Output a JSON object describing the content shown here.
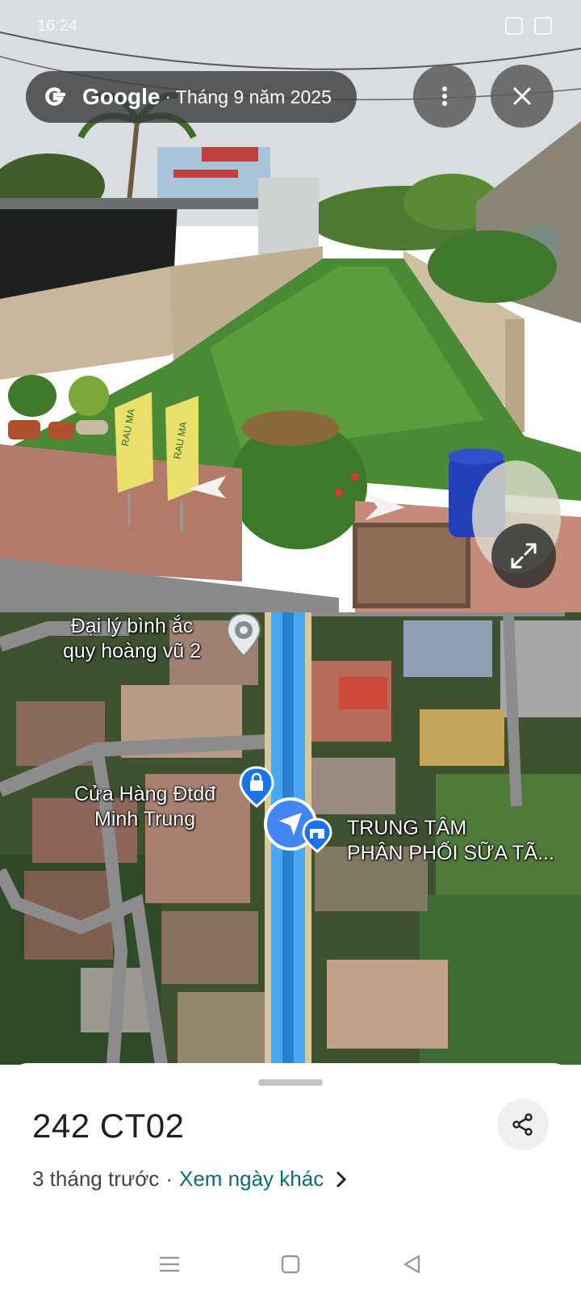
{
  "status_bar": {
    "time": "16:24"
  },
  "street_view": {
    "brand": "Google",
    "separator": "·",
    "capture_date": "Tháng 9 năm 2025"
  },
  "map": {
    "labels": [
      {
        "line1": "Đại lý bình ắc",
        "line2": "quy hoàng vũ 2"
      },
      {
        "line1": "Cửa Hàng Đtdđ",
        "line2": "Minh Trung"
      },
      {
        "line1": "TRUNG TÂM",
        "line2": "PHÂN PHỐI SỮA TÃ..."
      }
    ]
  },
  "sheet": {
    "title": "242 CT02",
    "age": "3 tháng trước",
    "separator": "·",
    "link": "Xem ngày khác"
  },
  "colors": {
    "accent": "#0b6b74",
    "pin_blue": "#1a73e8",
    "route_blue": "#4aa8f0"
  }
}
